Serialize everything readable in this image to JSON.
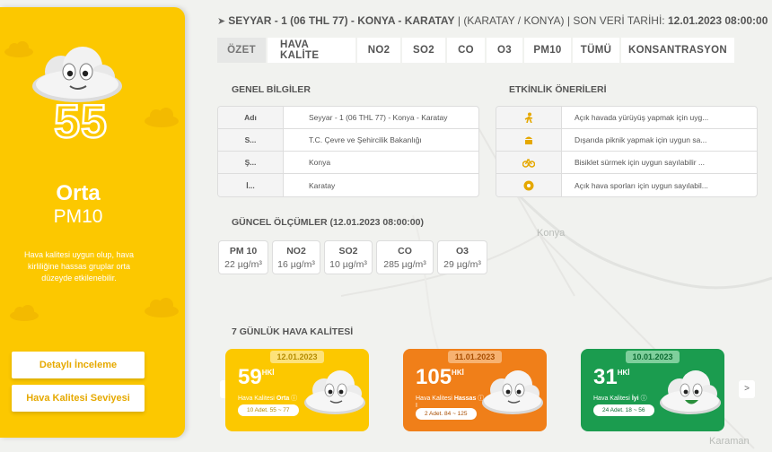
{
  "station": {
    "name": "SEYYAR - 1 (06 THL 77) - KONYA - KARATAY",
    "region": "(KARATAY / KONYA)",
    "last_data_label": "SON VERİ TARİHİ:",
    "last_data_date": "12.01.2023 08:00:00",
    "separator": "|"
  },
  "left_panel": {
    "aqi_value": "55",
    "level": "Orta",
    "pollutant": "PM10",
    "description": "Hava kalitesi uygun olup, hava kirliliğine hassas gruplar orta düzeyde etkilenebilir.",
    "detail_button": "Detaylı İnceleme",
    "levels_button": "Hava Kalitesi Seviyesi"
  },
  "tabs": [
    {
      "label": "ÖZET",
      "active": true
    },
    {
      "label": "HAVA KALİTE"
    },
    {
      "label": "NO2"
    },
    {
      "label": "SO2"
    },
    {
      "label": "CO"
    },
    {
      "label": "O3"
    },
    {
      "label": "PM10"
    },
    {
      "label": "TÜMÜ"
    },
    {
      "label": "KONSANTRASYON"
    }
  ],
  "general_info": {
    "title": "GENEL BİLGİLER",
    "rows": [
      {
        "key": "Adı",
        "value": "Seyyar - 1 (06 THL 77) - Konya - Karatay"
      },
      {
        "key": "S...",
        "value": "T.C. Çevre ve Şehircilik Bakanlığı"
      },
      {
        "key": "Ş...",
        "value": "Konya"
      },
      {
        "key": "İ...",
        "value": "Karatay"
      }
    ]
  },
  "activities": {
    "title": "ETKİNLİK ÖNERİLERİ",
    "rows": [
      {
        "icon": "walking-icon",
        "text": "Açık havada yürüyüş yapmak için uyg..."
      },
      {
        "icon": "picnic-icon",
        "text": "Dışarıda piknik yapmak için uygun sa..."
      },
      {
        "icon": "bicycle-icon",
        "text": "Bisiklet sürmek için uygun sayılabilir ..."
      },
      {
        "icon": "ball-icon",
        "text": "Açık hava sporları için uygun sayılabil..."
      }
    ]
  },
  "current": {
    "title": "GÜNCEL ÖLÇÜMLER (12.01.2023 08:00:00)",
    "items": [
      {
        "name": "PM 10",
        "value": "22 µg/m³"
      },
      {
        "name": "NO2",
        "value": "16 µg/m³"
      },
      {
        "name": "SO2",
        "value": "10 µg/m³"
      },
      {
        "name": "CO",
        "value": "285 µg/m³"
      },
      {
        "name": "O3",
        "value": "29 µg/m³"
      }
    ]
  },
  "weekly": {
    "title": "7 GÜNLÜK HAVA KALİTESİ",
    "prev_arrow": "<",
    "next_arrow": ">",
    "days": [
      {
        "date": "12.01.2023",
        "value": "59",
        "unit": "HKİ",
        "label_prefix": "Hava Kalitesi",
        "level": "Orta",
        "info": "ⓘ",
        "range": "10 Adet. 55 ~ 77",
        "color": "#fcc800"
      },
      {
        "date": "11.01.2023",
        "value": "105",
        "unit": "HKİ",
        "label_prefix": "Hava Kalitesi",
        "level": "Hassas",
        "info": "ⓘ",
        "extra": "I",
        "range": "2 Adet. 84 ~ 125",
        "color": "#f07f19"
      },
      {
        "date": "10.01.2023",
        "value": "31",
        "unit": "HKİ",
        "label_prefix": "Hava Kalitesi",
        "level": "İyi",
        "info": "ⓘ",
        "range": "24 Adet. 18 ~ 56",
        "color": "#1b9c4f"
      }
    ]
  },
  "map_labels": [
    "Konya",
    "Karaman"
  ]
}
